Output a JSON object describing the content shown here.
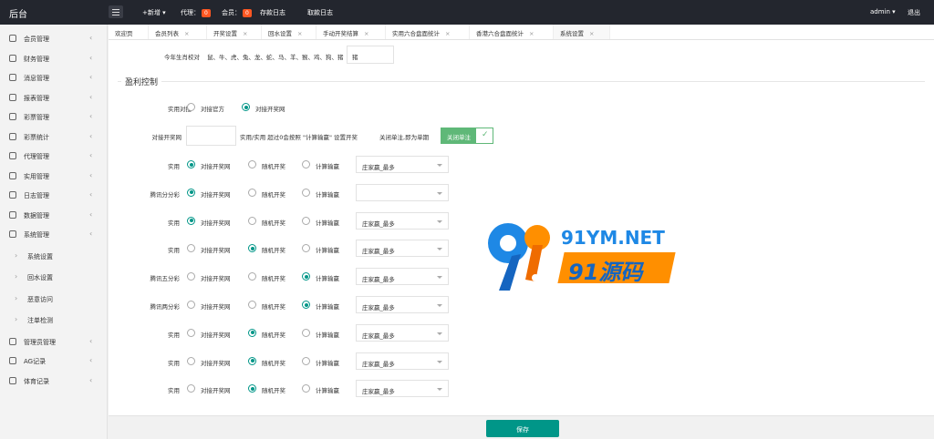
{
  "topbar": {
    "logo": "后台",
    "add_new": "+新增",
    "agent_label": "代理：",
    "agent_count": "0",
    "member_label": "会员：",
    "member_count": "0",
    "deposit_log": "存款日志",
    "withdraw_log": "取款日志",
    "user": "admin",
    "logout": "退出"
  },
  "sidebar": {
    "items": [
      {
        "label": "会员管理",
        "icon": "user-icon"
      },
      {
        "label": "财务管理",
        "icon": "finance-icon"
      },
      {
        "label": "消息管理",
        "icon": "message-icon"
      },
      {
        "label": "报表管理",
        "icon": "report-icon"
      },
      {
        "label": "彩票管理",
        "icon": "lottery-icon"
      },
      {
        "label": "彩票统计",
        "icon": "stats-icon"
      },
      {
        "label": "代理管理",
        "icon": "agent-icon"
      },
      {
        "label": "实用管理",
        "icon": "tool-icon"
      },
      {
        "label": "日志管理",
        "icon": "log-icon"
      },
      {
        "label": "数据管理",
        "icon": "data-icon"
      },
      {
        "label": "系统管理",
        "icon": "system-icon"
      }
    ],
    "sub_items": [
      "系统设置",
      "回水设置",
      "恶意访问",
      "注单检测"
    ],
    "bottom_items": [
      {
        "label": "管理员管理",
        "icon": "admin-icon"
      },
      {
        "label": "AG记录",
        "icon": "ag-icon"
      },
      {
        "label": "体育记录",
        "icon": "sport-icon"
      }
    ]
  },
  "tabs": [
    "欢迎页",
    "会员列表",
    "开奖设置",
    "回水设置",
    "手动开奖结算",
    "实用六合盘面统计",
    "香港六合盘面统计",
    "系统设置"
  ],
  "zodiac": {
    "label": "今年生肖校对",
    "list": "鼠、牛、虎、兔、龙、蛇、马、羊、猴、鸡、狗、猪",
    "value": "猪"
  },
  "section_title": "盈利控制",
  "connect": {
    "label": "实用对接",
    "options": [
      "对接官方",
      "对接开奖网"
    ],
    "selected": 1
  },
  "draw_site": {
    "label": "对接开奖网",
    "hint": "实用/实用 超过0会按照 \"计算输赢\" 设置开奖",
    "toggle_hint": "关闭单注,即为单期",
    "toggle_label": "关闭单注"
  },
  "options": [
    "对接开奖网",
    "随机开奖",
    "计算输赢"
  ],
  "rows": [
    {
      "label": "实用",
      "selected": 0,
      "select": "庄家赢_最多"
    },
    {
      "label": "腾讯分分彩",
      "selected": 0,
      "select": ""
    },
    {
      "label": "实用",
      "selected": 0,
      "select": "庄家赢_最多"
    },
    {
      "label": "实用",
      "selected": 1,
      "select": "庄家赢_最多"
    },
    {
      "label": "腾讯五分彩",
      "selected": 2,
      "select": "庄家赢_最多"
    },
    {
      "label": "腾讯两分彩",
      "selected": 2,
      "select": "庄家赢_最多"
    },
    {
      "label": "实用",
      "selected": 1,
      "select": "庄家赢_最多"
    },
    {
      "label": "实用",
      "selected": 1,
      "select": "庄家赢_最多"
    },
    {
      "label": "实用",
      "selected": 1,
      "select": "庄家赢_最多"
    }
  ],
  "watermark": {
    "line1": "91YM.NET",
    "line2": "91源码"
  },
  "save_label": "保存",
  "colors": {
    "accent": "#009688",
    "topbar": "#23262e",
    "badge": "#ff5722"
  }
}
